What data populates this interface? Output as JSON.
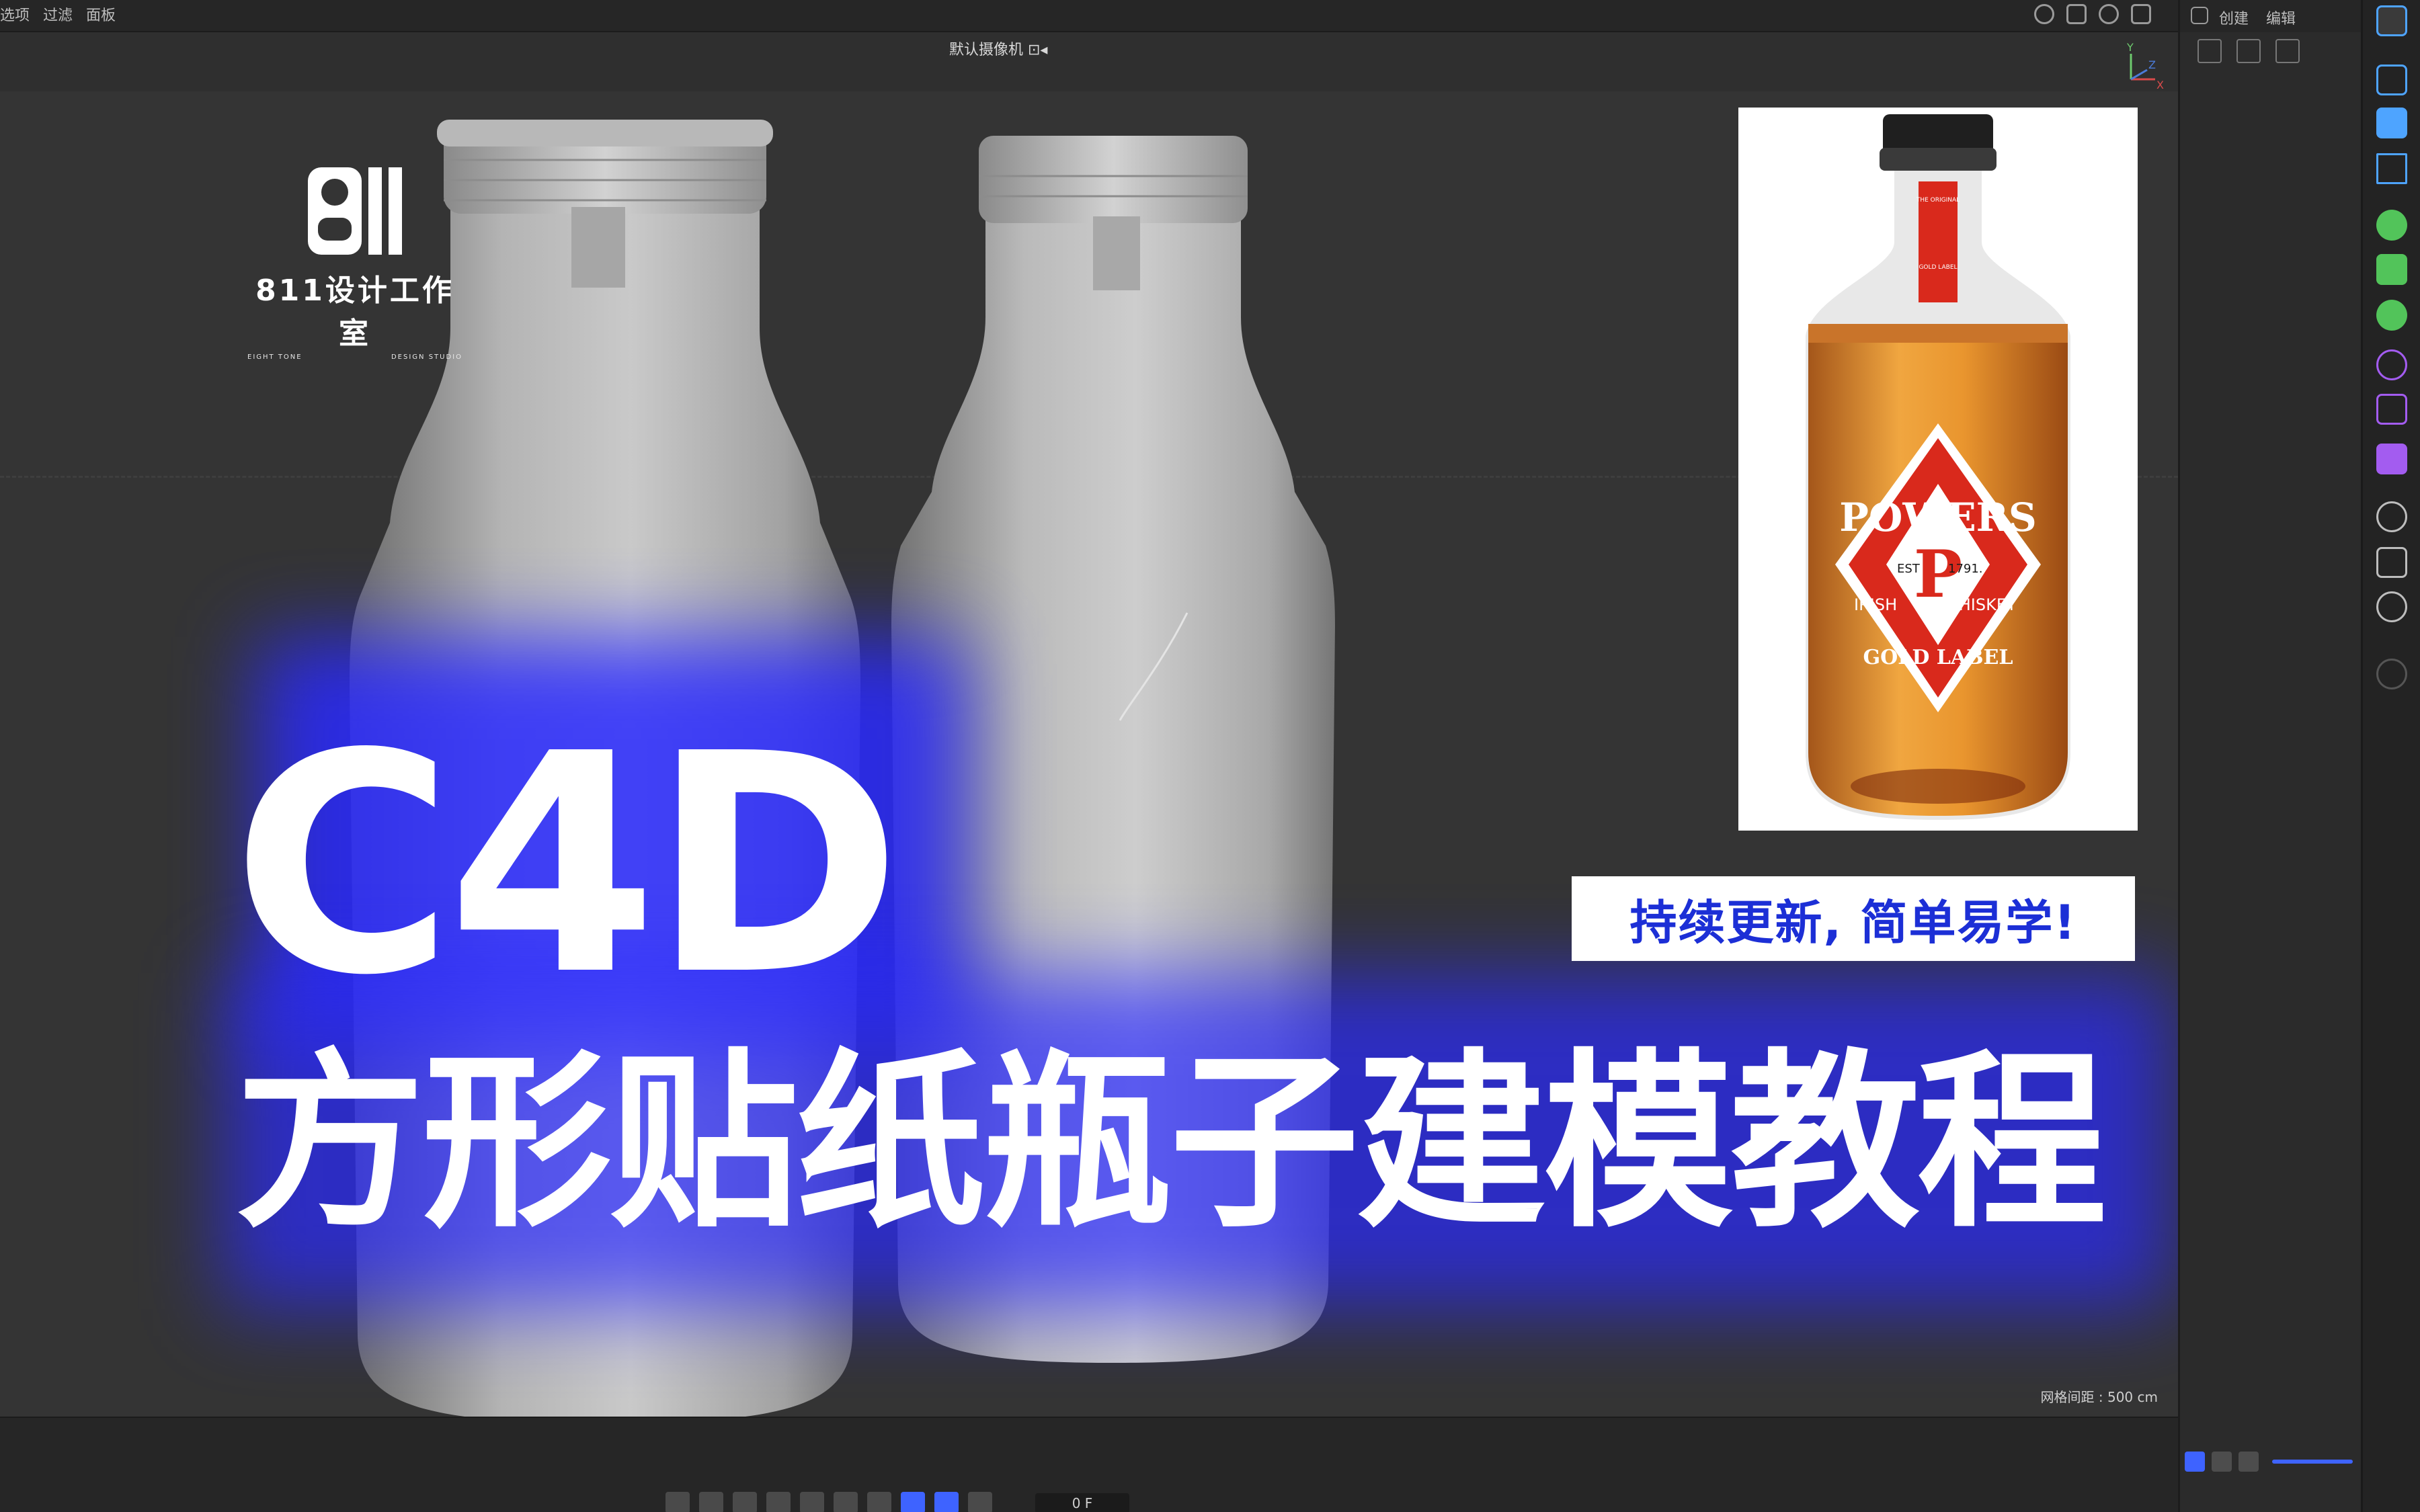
{
  "menu": {
    "items": [
      "选项",
      "过滤",
      "面板"
    ]
  },
  "viewport": {
    "camera_label": "默认摄像机 ⊡◂",
    "grid_info": "网格间距 : 500 cm",
    "axis_labels": {
      "y": "Y",
      "x": "X",
      "z": "Z"
    }
  },
  "logo": {
    "name": "811设计工作室",
    "sub_left": "EIGHT TONE",
    "sub_right": "DESIGN STUDIO"
  },
  "headline": {
    "main": "C4D",
    "sub": "方形贴纸瓶子建模教程"
  },
  "slogan": "持续更新, 简单易学!",
  "reference_photo": {
    "brand": "POWERS",
    "letter": "P",
    "est": "EST",
    "year": "1791.",
    "left_word": "IRISH",
    "right_word": "WHISKEY",
    "label": "GOLD LABEL",
    "small_top": "THE ORIGINAL",
    "neck_text": "GOLD LABEL"
  },
  "attributes_panel": {
    "create_label": "创建",
    "edit_label": "编辑"
  },
  "timeline": {
    "frame_value": "0 F"
  },
  "colors": {
    "accent_blue": "#3e63ff",
    "glow_blue": "#2a2aff",
    "slogan_text": "#1c2fd6",
    "whiskey_orange": "#e0892a",
    "label_red": "#d9291c"
  }
}
